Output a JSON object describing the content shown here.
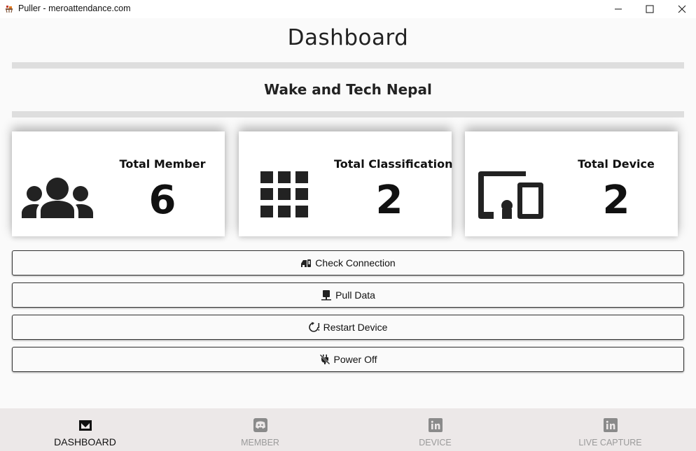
{
  "window": {
    "title": "Puller - meroattendance.com",
    "controls": {
      "minimize": "minimize-icon",
      "maximize": "maximize-icon",
      "close": "close-icon"
    }
  },
  "page": {
    "title": "Dashboard",
    "organization": "Wake and Tech Nepal"
  },
  "stats": [
    {
      "label": "Total Member",
      "value": "6",
      "icon": "group-icon"
    },
    {
      "label": "Total Classification",
      "value": "2",
      "icon": "grid-icon"
    },
    {
      "label": "Total Device",
      "value": "2",
      "icon": "devices-icon"
    }
  ],
  "actions": [
    {
      "label": "Check Connection",
      "icon": "connection-icon"
    },
    {
      "label": "Pull Data",
      "icon": "pull-data-icon"
    },
    {
      "label": "Restart Device",
      "icon": "restart-icon"
    },
    {
      "label": "Power Off",
      "icon": "power-off-icon"
    }
  ],
  "nav": {
    "selected": "DASHBOARD",
    "items": [
      {
        "label": "DASHBOARD",
        "icon": "mail-icon"
      },
      {
        "label": "MEMBER",
        "icon": "discord-icon"
      },
      {
        "label": "DEVICE",
        "icon": "linkedin-icon"
      },
      {
        "label": "LIVE CAPTURE",
        "icon": "linkedin-icon"
      }
    ]
  },
  "colors": {
    "background": "#fafafa",
    "nav_background": "#ece8e8",
    "divider": "#dedede",
    "icon_dark": "#222222",
    "nav_inactive": "#9a9a9a"
  }
}
